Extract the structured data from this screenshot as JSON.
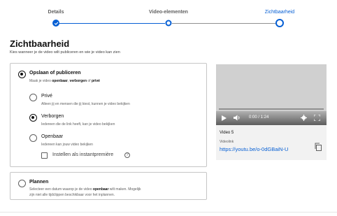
{
  "stepper": {
    "steps": [
      {
        "label": "Details",
        "state": "done"
      },
      {
        "label": "Video-elementen",
        "state": "visited"
      },
      {
        "label": "Zichtbaarheid",
        "state": "current"
      }
    ]
  },
  "page": {
    "title": "Zichtbaarheid",
    "subtitle": "Kies wanneer je de video wilt publiceren en wie je video kan zien"
  },
  "publish": {
    "title": "Opslaan of publiceren",
    "desc_prefix": "Maak je video ",
    "desc_b1": "openbaar",
    "desc_mid1": ", ",
    "desc_b2": "verborgen",
    "desc_mid2": " of ",
    "desc_b3": "privé",
    "options": [
      {
        "title": "Privé",
        "desc": "Alleen jij en mensen die jij kiest, kunnen je video bekijken",
        "checked": false
      },
      {
        "title": "Verborgen",
        "desc": "Iedereen die de link heeft, kan je video bekijken",
        "checked": true
      },
      {
        "title": "Openbaar",
        "desc": "Iedereen kan jouw video bekijken",
        "checked": false
      }
    ],
    "premiere_label": "Instellen als instantpremière",
    "premiere_checked": false
  },
  "plan": {
    "title": "Plannen",
    "desc_line1_a": "Selecteer een datum waarop je de video ",
    "desc_line1_b": "openbaar",
    "desc_line1_c": " wilt maken. Mogelijk",
    "desc_line2": "zijn niet alle tijdclippen beschikbaar voor het inplannen."
  },
  "video": {
    "time": "0:00 / 1:24",
    "title": "Video 5",
    "link_label": "Videolink",
    "link": "https://youtu.be/o-0dGBaiN-U"
  },
  "colors": {
    "accent": "#065fd4",
    "link": "#065fd4"
  }
}
